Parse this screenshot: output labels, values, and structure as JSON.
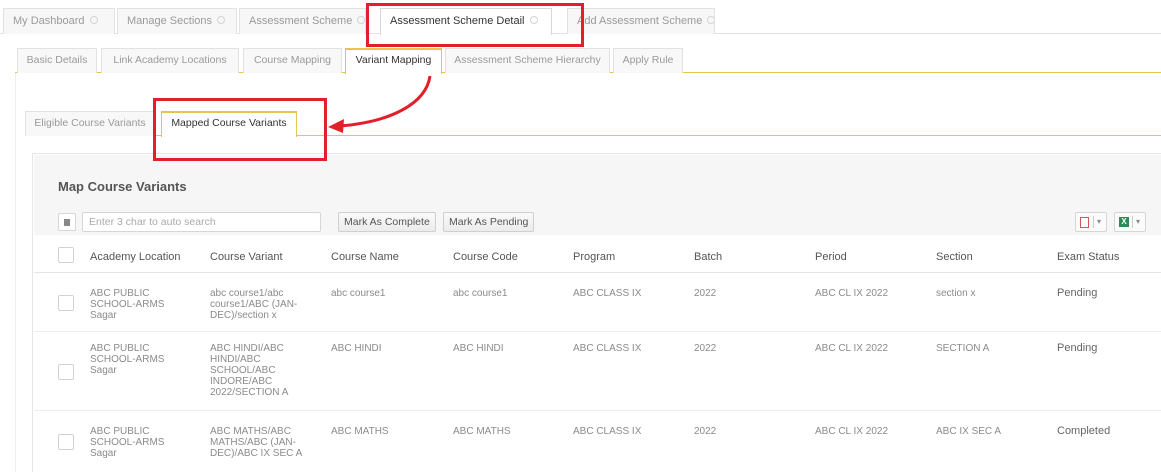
{
  "top_tabs": [
    {
      "label": "My Dashboard"
    },
    {
      "label": "Manage Sections"
    },
    {
      "label": "Assessment Scheme"
    },
    {
      "label": "Assessment Scheme Detail"
    },
    {
      "label": "Add Assessment Scheme"
    }
  ],
  "sub_tabs": [
    {
      "label": "Basic Details"
    },
    {
      "label": "Link Academy Locations"
    },
    {
      "label": "Course Mapping"
    },
    {
      "label": "Variant Mapping"
    },
    {
      "label": "Assessment Scheme Hierarchy"
    },
    {
      "label": "Apply Rule"
    }
  ],
  "inner_tabs": [
    {
      "label": "Eligible Course Variants"
    },
    {
      "label": "Mapped Course Variants"
    }
  ],
  "panel": {
    "title": "Map Course Variants",
    "search_placeholder": "Enter 3 char to auto search",
    "mark_complete_label": "Mark As Complete",
    "mark_pending_label": "Mark As Pending",
    "pdf_icon": "pdf-export-icon",
    "excel_icon": "excel-export-icon",
    "excel_glyph": "X",
    "caret_glyph": "▾"
  },
  "table": {
    "headers": [
      "Academy Location",
      "Course Variant",
      "Course Name",
      "Course Code",
      "Program",
      "Batch",
      "Period",
      "Section",
      "Exam Status"
    ],
    "rows": [
      {
        "academy_location": "ABC PUBLIC SCHOOL-ARMS Sagar",
        "course_variant": "abc course1/abc course1/ABC (JAN-DEC)/section x",
        "course_name": "abc course1",
        "course_code": "abc course1",
        "program": "ABC CLASS IX",
        "batch": "2022",
        "period": "ABC CL IX 2022",
        "section": "section x",
        "exam_status": "Pending"
      },
      {
        "academy_location": "ABC PUBLIC SCHOOL-ARMS Sagar",
        "course_variant": "ABC HINDI/ABC HINDI/ABC SCHOOL/ABC INDORE/ABC 2022/SECTION A",
        "course_name": "ABC HINDI",
        "course_code": "ABC HINDI",
        "program": "ABC CLASS IX",
        "batch": "2022",
        "period": "ABC CL IX 2022",
        "section": "SECTION A",
        "exam_status": "Pending"
      },
      {
        "academy_location": "ABC PUBLIC SCHOOL-ARMS Sagar",
        "course_variant": "ABC MATHS/ABC MATHS/ABC (JAN-DEC)/ABC IX SEC A",
        "course_name": "ABC MATHS",
        "course_code": "ABC MATHS",
        "program": "ABC CLASS IX",
        "batch": "2022",
        "period": "ABC CL IX 2022",
        "section": "ABC IX SEC A",
        "exam_status": "Completed"
      }
    ]
  },
  "colors": {
    "highlight": "#e0202a",
    "active_tab_accent": "#e6c54d"
  }
}
